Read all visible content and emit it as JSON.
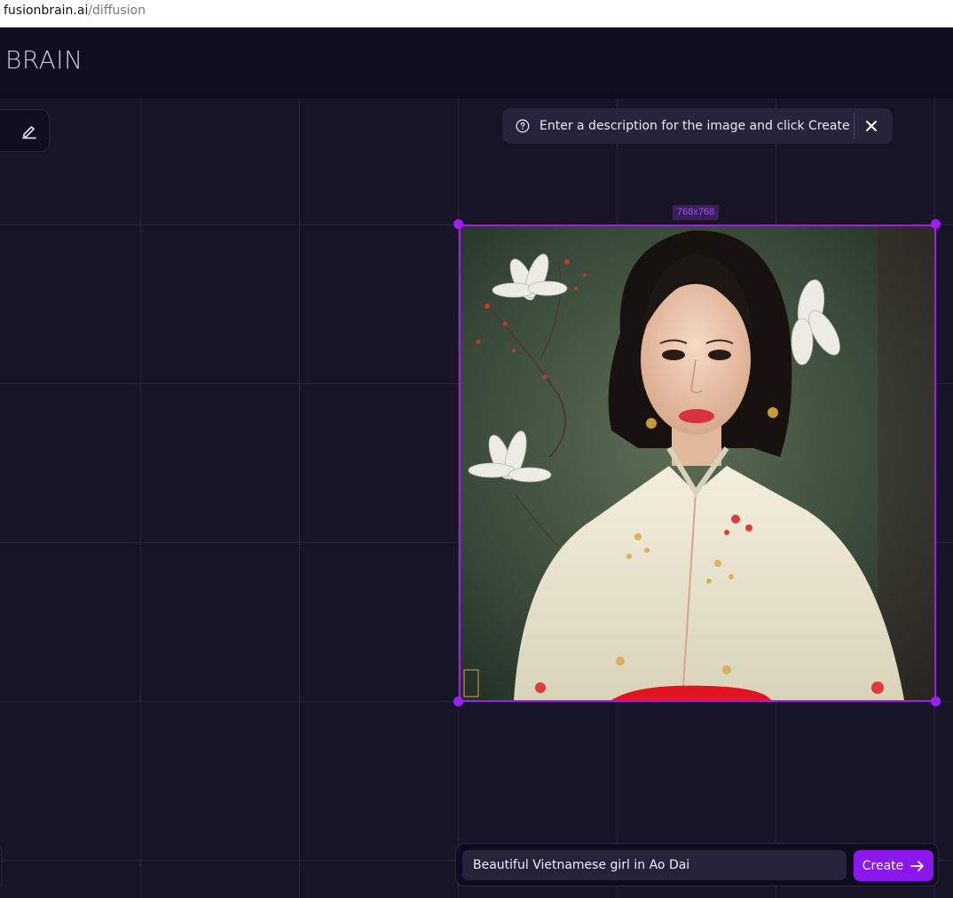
{
  "browser": {
    "host": "fusionbrain.ai",
    "path": "/diffusion"
  },
  "header": {
    "logo_text": "BRAIN"
  },
  "hint": {
    "text": "Enter a description for the image and click Create",
    "icon": "question-circle-icon",
    "close_icon": "close-icon"
  },
  "canvas": {
    "selection_size_label": "768x768",
    "image_subject": "painted portrait of a young woman in a white ao dai with white lotus flowers on a dark green background",
    "accent_color": "#9b1ef2"
  },
  "toolbar": {
    "tool_icon": "pencil-eraser-icon"
  },
  "prompt": {
    "value": "Beautiful Vietnamese girl in Ao Dai",
    "button_label": "Create",
    "button_icon": "arrow-right-icon"
  }
}
